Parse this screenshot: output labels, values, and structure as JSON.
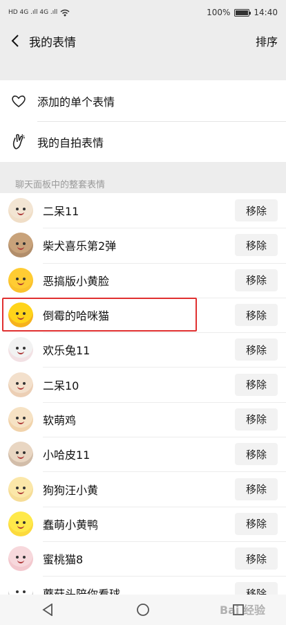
{
  "status": {
    "signal_left": "HD 4G .ıll 4G .ıll",
    "battery_pct": "100%",
    "time": "14:40"
  },
  "header": {
    "title": "我的表情",
    "sort_label": "排序"
  },
  "top_items": [
    {
      "label": "添加的单个表情",
      "icon": "heart-outline-icon"
    },
    {
      "label": "我的自拍表情",
      "icon": "hand-gesture-icon"
    }
  ],
  "section_label": "聊天面板中的整套表情",
  "stickers": [
    {
      "title": "二呆11",
      "remove": "移除",
      "color": "#f3e5d3",
      "accent": "#e8c59a"
    },
    {
      "title": "柴犬喜乐第2弹",
      "remove": "移除",
      "color": "#c8a27a",
      "accent": "#5b4330"
    },
    {
      "title": "恶搞版小黄脸",
      "remove": "移除",
      "color": "#ffcc33",
      "accent": "#e59d1a"
    },
    {
      "title": "倒霉的哈咪猫",
      "remove": "移除",
      "color": "#ffd41a",
      "accent": "#d12e2e"
    },
    {
      "title": "欢乐兔11",
      "remove": "移除",
      "color": "#f2f2f2",
      "accent": "#f5a0b0"
    },
    {
      "title": "二呆10",
      "remove": "移除",
      "color": "#f3e0cc",
      "accent": "#d08c5a"
    },
    {
      "title": "软萌鸡",
      "remove": "移除",
      "color": "#f6e2c4",
      "accent": "#e09a4a"
    },
    {
      "title": "小哈皮11",
      "remove": "移除",
      "color": "#e9d6c2",
      "accent": "#7a5a44"
    },
    {
      "title": "狗狗汪小黄",
      "remove": "移除",
      "color": "#fbe7a9",
      "accent": "#e6b84f"
    },
    {
      "title": "蠢萌小黄鸭",
      "remove": "移除",
      "color": "#ffe94a",
      "accent": "#f0a20a"
    },
    {
      "title": "蜜桃猫8",
      "remove": "移除",
      "color": "#f7d8dc",
      "accent": "#e88b98"
    },
    {
      "title": "蘑菇头陪你看球",
      "remove": "移除",
      "color": "#ffffff",
      "accent": "#222222"
    }
  ],
  "watermark": "Bai 经验"
}
